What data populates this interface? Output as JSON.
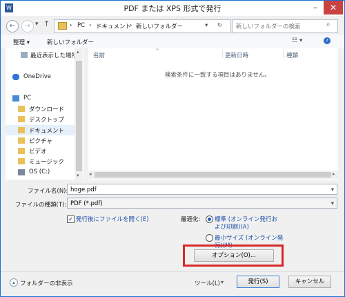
{
  "window": {
    "title": "PDF または XPS 形式で発行",
    "app_icon": "W"
  },
  "nav": {
    "breadcrumb": [
      "PC",
      "ドキュメント",
      "新しいフォルダー"
    ],
    "search_placeholder": "新しいフォルダーの検索"
  },
  "toolbar": {
    "organize_label": "整理 ▾",
    "new_folder_label": "新しいフォルダー"
  },
  "sidebar": {
    "items": [
      "最近表示した場所",
      "OneDrive",
      "PC",
      "ダウンロード",
      "デスクトップ",
      "ドキュメント",
      "ピクチャ",
      "ビデオ",
      "ミュージック",
      "OS (C:)"
    ]
  },
  "filelist": {
    "columns": [
      "名前",
      "更新日時",
      "種類"
    ],
    "empty_message": "検索条件に一致する項目はありません。"
  },
  "form": {
    "filename_label": "ファイル名(N):",
    "filename_value": "hoge.pdf",
    "filetype_label": "ファイルの種類(T):",
    "filetype_value": "PDF (*.pdf)",
    "open_after_label": "発行後にファイルを開く(E)",
    "optimize_label": "最適化:",
    "standard_label_1": "標準 (オンライン発行お",
    "standard_label_2": "よび印刷)(A)",
    "minimum_label_1": "最小サイズ (オンライン発",
    "minimum_label_2": "行)(M)",
    "options_label": "オプション(O)..."
  },
  "footer": {
    "hide_folders_label": "フォルダーの非表示",
    "tools_label": "ツール(L)",
    "publish_label": "発行(S)",
    "cancel_label": "キャンセル"
  },
  "colors": {
    "highlight_box": "#d62828",
    "accent": "#1c6fd1"
  }
}
